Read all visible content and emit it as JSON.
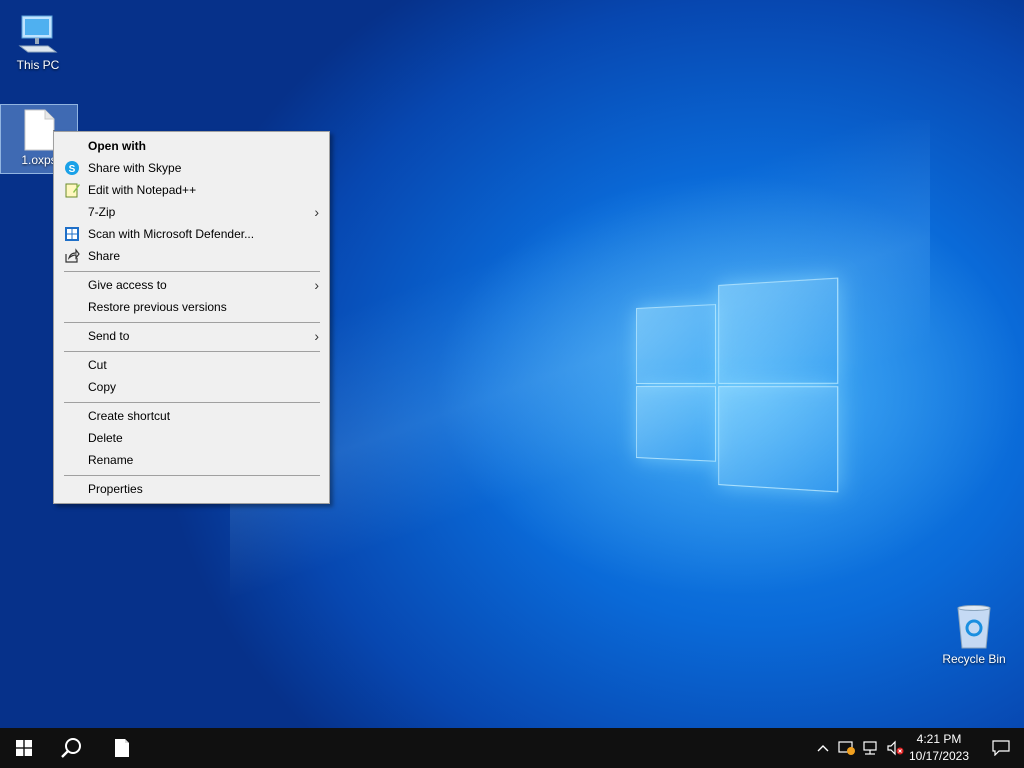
{
  "desktop": {
    "icons": [
      {
        "label": "This PC"
      },
      {
        "label": "1.oxps"
      },
      {
        "label": "Recycle Bin"
      }
    ]
  },
  "context_menu": {
    "items": [
      {
        "label": "Open with"
      },
      {
        "label": "Share with Skype"
      },
      {
        "label": "Edit with Notepad++"
      },
      {
        "label": "7-Zip"
      },
      {
        "label": "Scan with Microsoft Defender..."
      },
      {
        "label": "Share"
      },
      {
        "label": "Give access to"
      },
      {
        "label": "Restore previous versions"
      },
      {
        "label": "Send to"
      },
      {
        "label": "Cut"
      },
      {
        "label": "Copy"
      },
      {
        "label": "Create shortcut"
      },
      {
        "label": "Delete"
      },
      {
        "label": "Rename"
      },
      {
        "label": "Properties"
      }
    ]
  },
  "taskbar": {
    "time": "4:21 PM",
    "date": "10/17/2023"
  },
  "colors": {
    "taskbar": "#101010",
    "menu_bg": "#f0f0f0",
    "accent": "#0a6ad8"
  }
}
